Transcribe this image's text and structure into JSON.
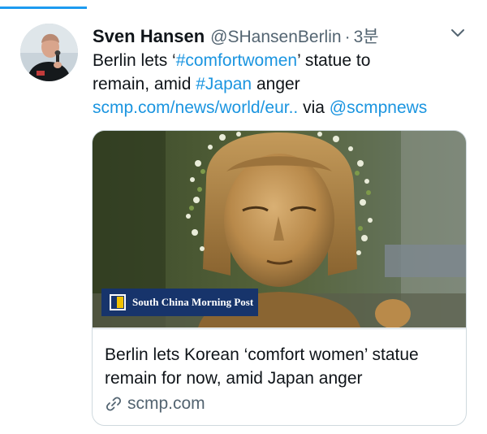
{
  "tweet": {
    "author_name": "Sven Hansen",
    "handle": "@SHansenBerlin",
    "separator": "·",
    "time": "3분",
    "text": {
      "line1_a": "Berlin lets ‘",
      "line1_hashtag": "#comfortwomen",
      "line1_b": "’ statue to",
      "line2_a": "remain, amid ",
      "line2_hashtag": "#Japan",
      "line2_b": " anger",
      "line3_link": "scmp.com/news/world/eur..",
      "line3_via": " via ",
      "line3_mention": "@scmpnews"
    }
  },
  "card": {
    "publisher_badge": "South China Morning Post",
    "title_line1": "Berlin lets Korean ‘comfort women’ statue",
    "title_line2": "remain for now, amid Japan anger",
    "domain": "scmp.com"
  },
  "colors": {
    "accent": "#1d9bf0",
    "link": "#1b95e0",
    "muted": "#536471",
    "badge": "#17346b",
    "badge_logo": "#f2c200"
  },
  "icons": {
    "menu": "chevron-down-icon",
    "card_link": "link-icon"
  }
}
